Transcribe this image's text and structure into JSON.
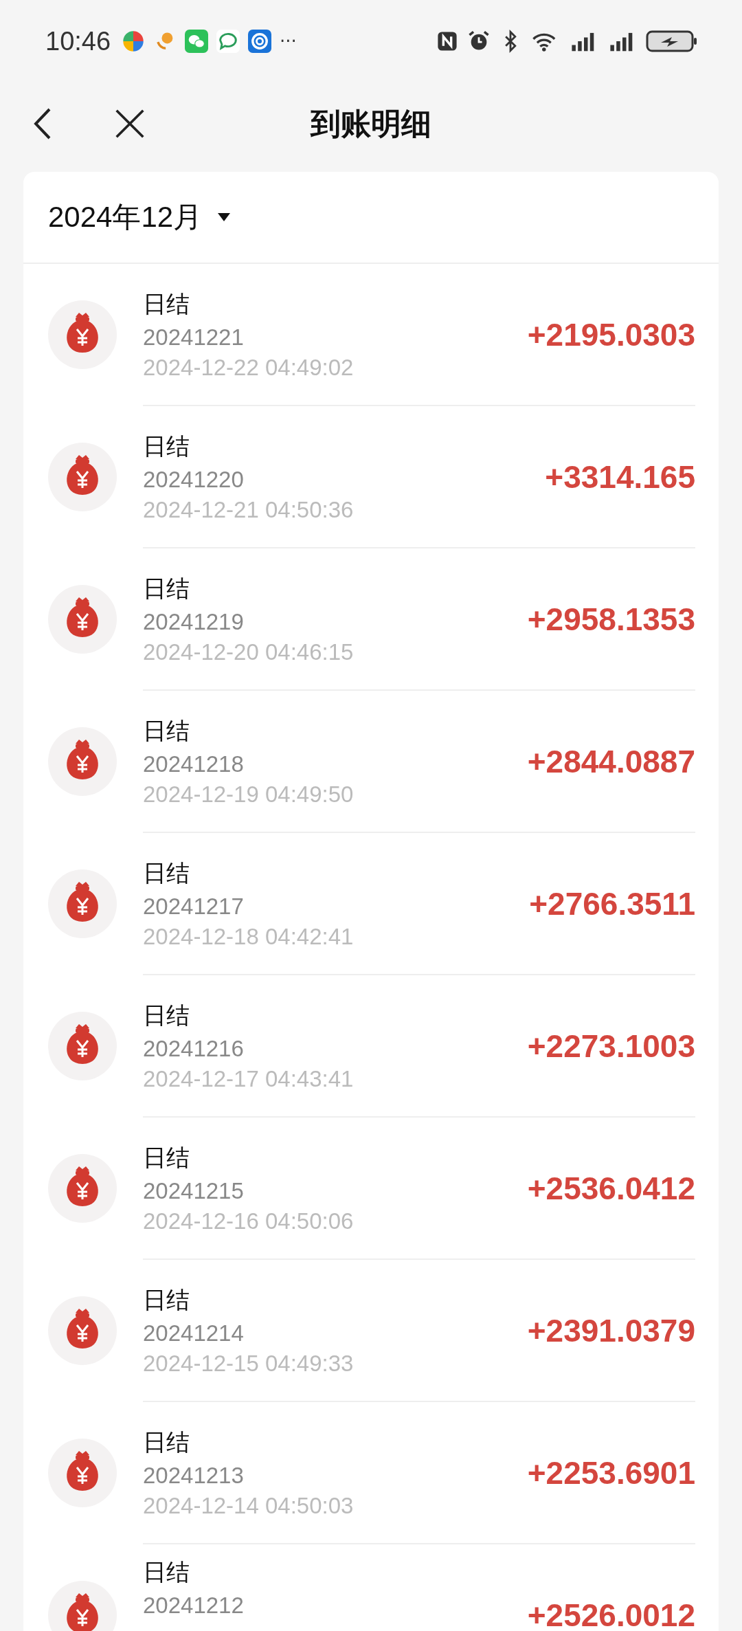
{
  "status_bar": {
    "time": "10:46",
    "more": "···"
  },
  "header": {
    "title": "到账明细"
  },
  "month_picker": {
    "label": "2024年12月"
  },
  "records": [
    {
      "type": "日结",
      "batch": "20241221",
      "time": "2024-12-22 04:49:02",
      "amount": "+2195.0303"
    },
    {
      "type": "日结",
      "batch": "20241220",
      "time": "2024-12-21 04:50:36",
      "amount": "+3314.165"
    },
    {
      "type": "日结",
      "batch": "20241219",
      "time": "2024-12-20 04:46:15",
      "amount": "+2958.1353"
    },
    {
      "type": "日结",
      "batch": "20241218",
      "time": "2024-12-19 04:49:50",
      "amount": "+2844.0887"
    },
    {
      "type": "日结",
      "batch": "20241217",
      "time": "2024-12-18 04:42:41",
      "amount": "+2766.3511"
    },
    {
      "type": "日结",
      "batch": "20241216",
      "time": "2024-12-17 04:43:41",
      "amount": "+2273.1003"
    },
    {
      "type": "日结",
      "batch": "20241215",
      "time": "2024-12-16 04:50:06",
      "amount": "+2536.0412"
    },
    {
      "type": "日结",
      "batch": "20241214",
      "time": "2024-12-15 04:49:33",
      "amount": "+2391.0379"
    },
    {
      "type": "日结",
      "batch": "20241213",
      "time": "2024-12-14 04:50:03",
      "amount": "+2253.6901"
    },
    {
      "type": "日结",
      "batch": "20241212",
      "amount": "+2526.0012"
    }
  ]
}
